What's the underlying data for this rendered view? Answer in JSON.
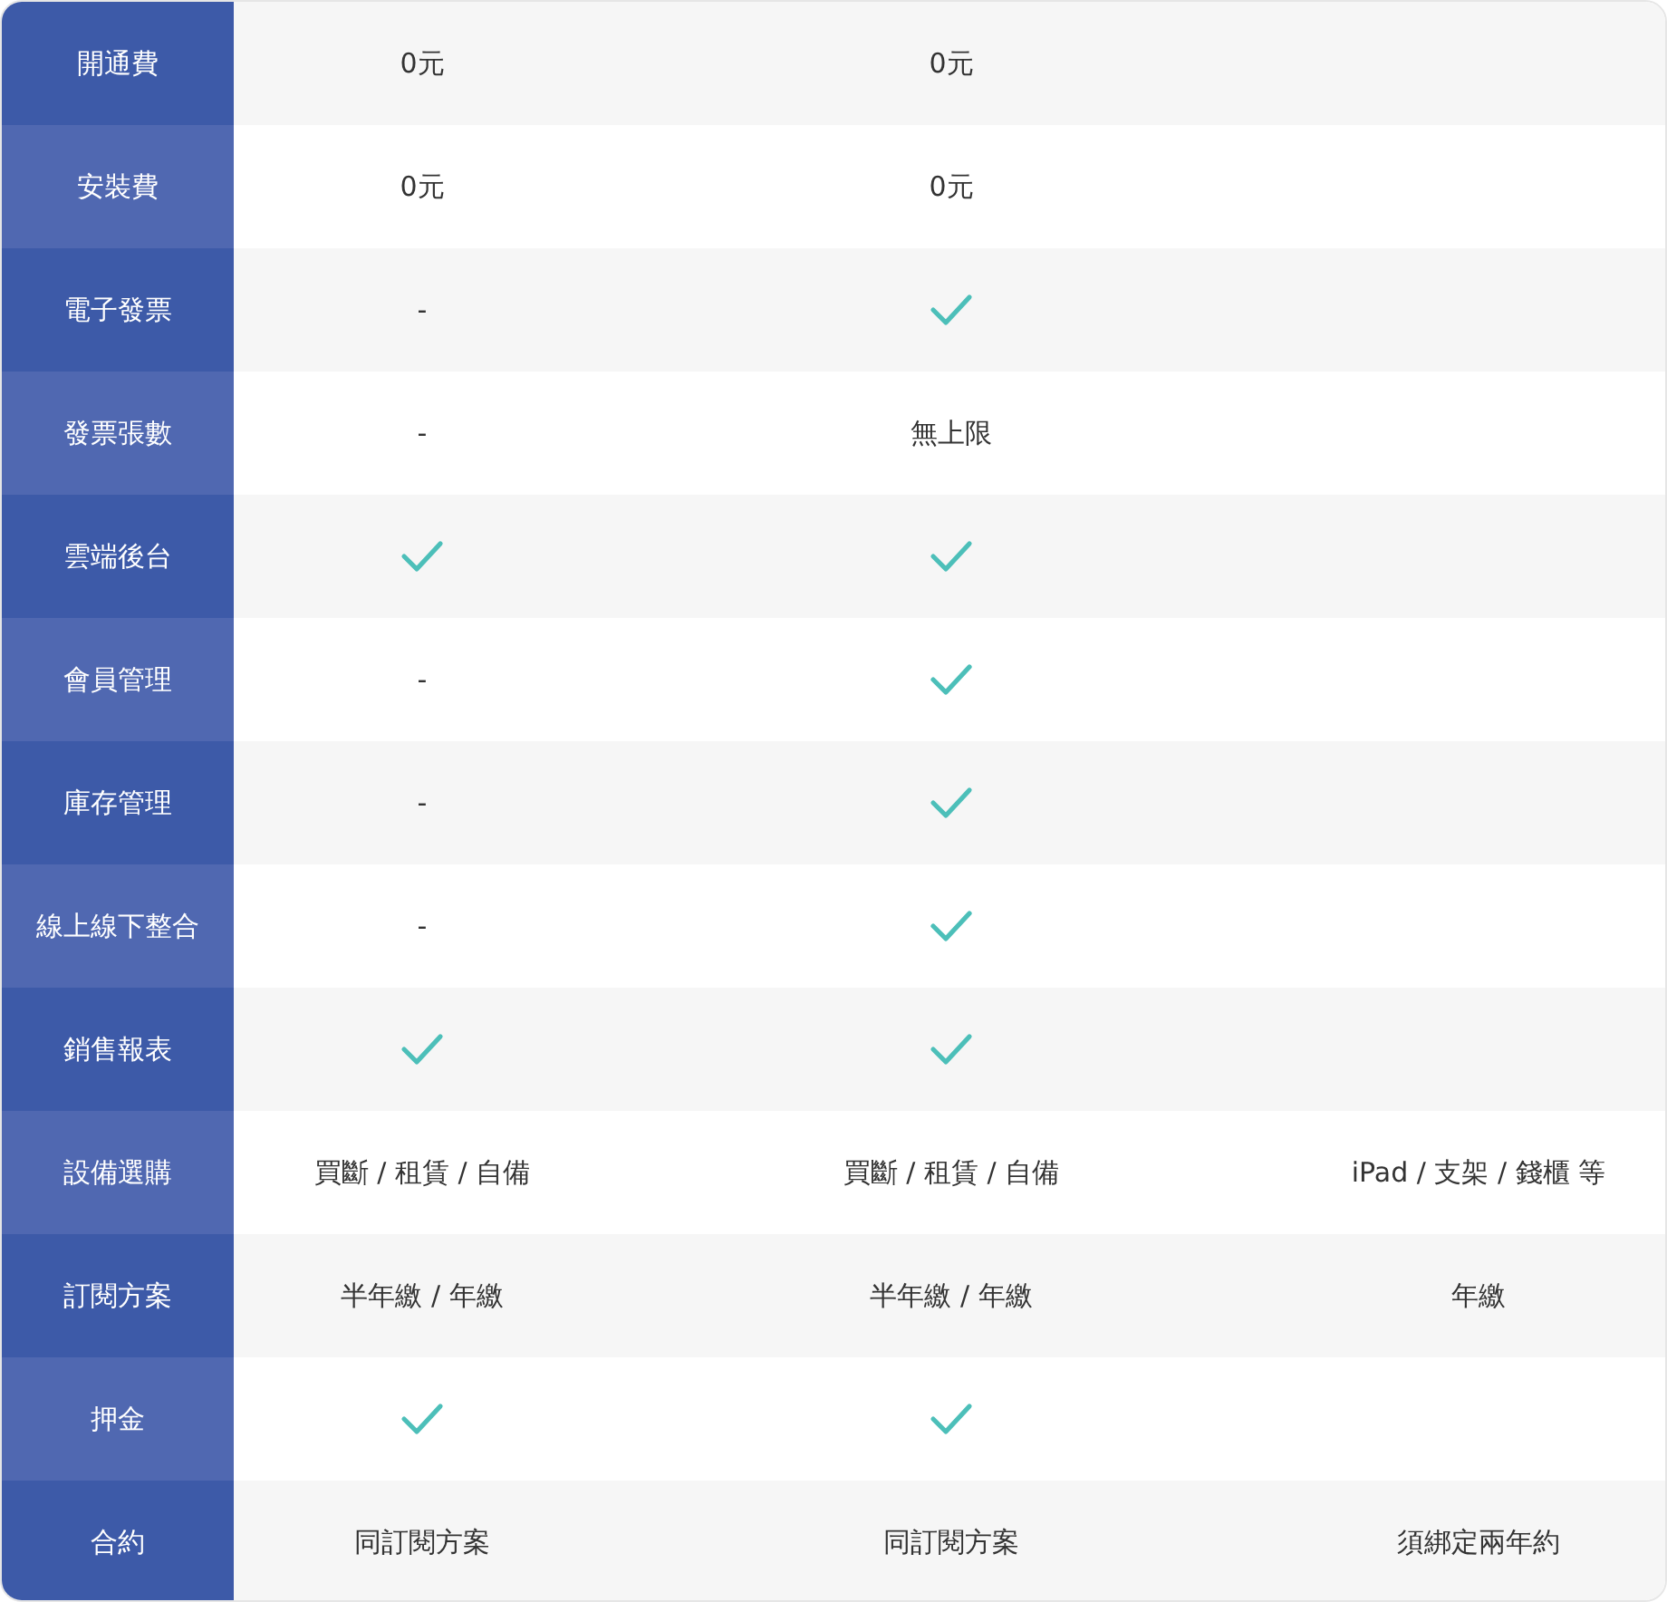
{
  "rows": [
    {
      "label": "開通費",
      "cells": [
        {
          "kind": "text",
          "text": "0元"
        },
        {
          "kind": "text",
          "text": "0元"
        },
        {
          "kind": "blank"
        }
      ]
    },
    {
      "label": "安裝費",
      "cells": [
        {
          "kind": "text",
          "text": "0元"
        },
        {
          "kind": "text",
          "text": "0元"
        },
        {
          "kind": "blank"
        }
      ]
    },
    {
      "label": "電子發票",
      "cells": [
        {
          "kind": "text",
          "text": "-"
        },
        {
          "kind": "check"
        },
        {
          "kind": "blank"
        }
      ]
    },
    {
      "label": "發票張數",
      "cells": [
        {
          "kind": "text",
          "text": "-"
        },
        {
          "kind": "text",
          "text": "無上限"
        },
        {
          "kind": "blank"
        }
      ]
    },
    {
      "label": "雲端後台",
      "cells": [
        {
          "kind": "check"
        },
        {
          "kind": "check"
        },
        {
          "kind": "blank"
        }
      ]
    },
    {
      "label": "會員管理",
      "cells": [
        {
          "kind": "text",
          "text": "-"
        },
        {
          "kind": "check"
        },
        {
          "kind": "blank"
        }
      ]
    },
    {
      "label": "庫存管理",
      "cells": [
        {
          "kind": "text",
          "text": "-"
        },
        {
          "kind": "check"
        },
        {
          "kind": "blank"
        }
      ]
    },
    {
      "label": "線上線下整合",
      "cells": [
        {
          "kind": "text",
          "text": "-"
        },
        {
          "kind": "check"
        },
        {
          "kind": "blank"
        }
      ]
    },
    {
      "label": "銷售報表",
      "cells": [
        {
          "kind": "check"
        },
        {
          "kind": "check"
        },
        {
          "kind": "blank"
        }
      ]
    },
    {
      "label": "設備選購",
      "cells": [
        {
          "kind": "text",
          "text": "買斷 / 租賃 / 自備"
        },
        {
          "kind": "text",
          "text": "買斷 / 租賃 / 自備"
        },
        {
          "kind": "text",
          "text": "iPad / 支架 / 錢櫃 等"
        }
      ]
    },
    {
      "label": "訂閱方案",
      "cells": [
        {
          "kind": "text",
          "text": "半年繳 / 年繳"
        },
        {
          "kind": "text",
          "text": "半年繳 / 年繳"
        },
        {
          "kind": "text",
          "text": "年繳"
        }
      ]
    },
    {
      "label": "押金",
      "cells": [
        {
          "kind": "check"
        },
        {
          "kind": "check"
        },
        {
          "kind": "blank"
        }
      ]
    },
    {
      "label": "合約",
      "cells": [
        {
          "kind": "text",
          "text": "同訂閱方案"
        },
        {
          "kind": "text",
          "text": "同訂閱方案"
        },
        {
          "kind": "text",
          "text": "須綁定兩年約"
        }
      ]
    }
  ]
}
